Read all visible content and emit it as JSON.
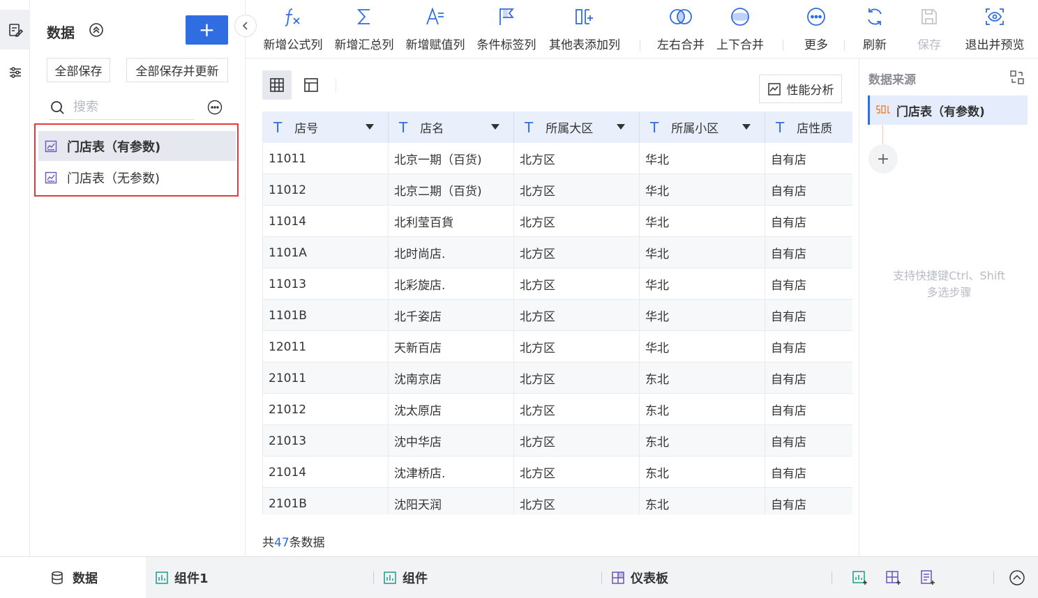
{
  "sidebar": {
    "title": "数据",
    "add_label": "+",
    "save_all": "全部保存",
    "save_all_update": "全部保存并更新",
    "search_placeholder": "搜索",
    "datasets": [
      {
        "label": "门店表（有参数)",
        "selected": true
      },
      {
        "label": "门店表（无参数)",
        "selected": false
      }
    ]
  },
  "toolbar": {
    "items": [
      {
        "label": "新增公式列",
        "icon": "formula-icon"
      },
      {
        "label": "新增汇总列",
        "icon": "sigma-icon"
      },
      {
        "label": "新增赋值列",
        "icon": "assign-icon"
      },
      {
        "label": "条件标签列",
        "icon": "flag-icon"
      },
      {
        "label": "其他表添加列",
        "icon": "add-column-icon"
      },
      {
        "label": "左右合并",
        "icon": "merge-horizontal-icon"
      },
      {
        "label": "上下合并",
        "icon": "merge-vertical-icon"
      },
      {
        "label": "更多",
        "icon": "more-icon"
      },
      {
        "label": "刷新",
        "icon": "refresh-icon"
      },
      {
        "label": "保存",
        "icon": "save-icon",
        "disabled": true
      },
      {
        "label": "退出并预览",
        "icon": "preview-icon"
      }
    ]
  },
  "main": {
    "perf_label": "性能分析",
    "columns": [
      "店号",
      "店名",
      "所属大区",
      "所属小区",
      "店性质"
    ],
    "column_type_glyph": "T",
    "rows": [
      [
        "11011",
        "北京一期（百货)",
        "北方区",
        "华北",
        "自有店"
      ],
      [
        "11012",
        "北京二期（百货)",
        "北方区",
        "华北",
        "自有店"
      ],
      [
        "11014",
        "北利莹百貨",
        "北方区",
        "华北",
        "自有店"
      ],
      [
        "1101A",
        "北时尚店.",
        "北方区",
        "华北",
        "自有店"
      ],
      [
        "11013",
        "北彩旋店.",
        "北方区",
        "华北",
        "自有店"
      ],
      [
        "1101B",
        "北千姿店",
        "北方区",
        "华北",
        "自有店"
      ],
      [
        "12011",
        "天新百店",
        "北方区",
        "华北",
        "自有店"
      ],
      [
        "21011",
        "沈南京店",
        "北方区",
        "东北",
        "自有店"
      ],
      [
        "21012",
        "沈太原店",
        "北方区",
        "东北",
        "自有店"
      ],
      [
        "21013",
        "沈中华店",
        "北方区",
        "东北",
        "自有店"
      ],
      [
        "21014",
        "沈津桥店.",
        "北方区",
        "东北",
        "自有店"
      ],
      [
        "2101B",
        "沈阳天润",
        "北方区",
        "东北",
        "自有店"
      ]
    ],
    "count_prefix": "共",
    "count": "47",
    "count_suffix": "条数据"
  },
  "right_panel": {
    "title": "数据来源",
    "step_label": "门店表（有参数)",
    "add_label": "+",
    "hint_line1": "支持快捷键Ctrl、Shift",
    "hint_line2": "多选步骤"
  },
  "bottom": {
    "tabs": [
      {
        "label": "数据",
        "icon": "database-icon",
        "active": true
      },
      {
        "label": "组件1",
        "icon": "chart-icon"
      },
      {
        "label": "组件",
        "icon": "chart-icon"
      },
      {
        "label": "仪表板",
        "icon": "dashboard-icon"
      }
    ]
  },
  "colors": {
    "accent": "#2f6de1",
    "highlight": "#e53a3a",
    "header_bg": "#eaf0fb"
  }
}
